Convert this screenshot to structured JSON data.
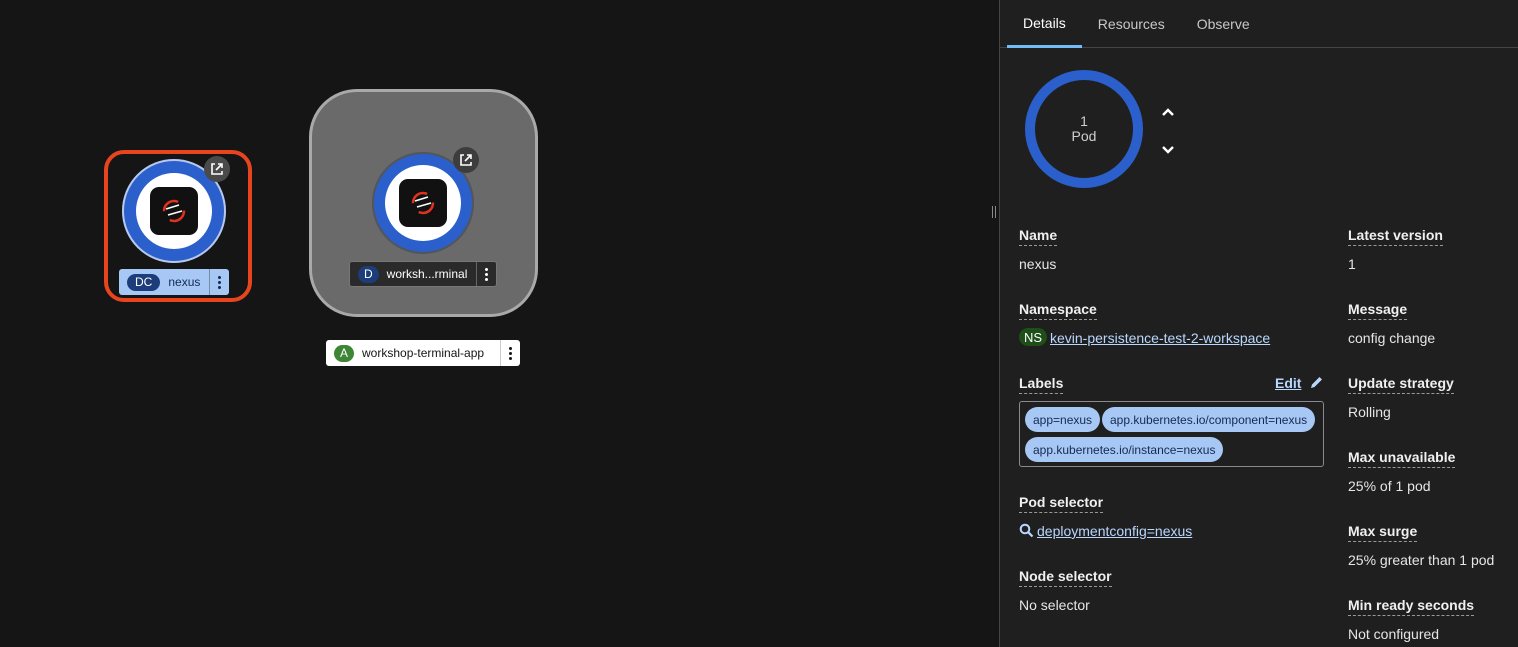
{
  "topology": {
    "nodes": [
      {
        "badge": "DC",
        "name": "nexus",
        "selected": true
      },
      {
        "badge": "D",
        "name": "worksh...rminal"
      }
    ],
    "application": {
      "badge": "A",
      "name": "workshop-terminal-app"
    }
  },
  "panel": {
    "tabs": [
      {
        "label": "Details",
        "active": true
      },
      {
        "label": "Resources"
      },
      {
        "label": "Observe"
      }
    ],
    "pods": {
      "count": "1",
      "unit": "Pod"
    },
    "fields": {
      "name": {
        "label": "Name",
        "value": "nexus"
      },
      "namespace": {
        "label": "Namespace",
        "badge": "NS",
        "value": "kevin-persistence-test-2-workspace"
      },
      "labels": {
        "label": "Labels",
        "edit": "Edit",
        "chips": [
          "app=nexus",
          "app.kubernetes.io/component=nexus",
          "app.kubernetes.io/instance=nexus"
        ]
      },
      "pod_selector": {
        "label": "Pod selector",
        "value": "deploymentconfig=nexus"
      },
      "node_selector": {
        "label": "Node selector",
        "value": "No selector"
      },
      "latest_version": {
        "label": "Latest version",
        "value": "1"
      },
      "message": {
        "label": "Message",
        "value": "config change"
      },
      "update_strategy": {
        "label": "Update strategy",
        "value": "Rolling"
      },
      "max_unavailable": {
        "label": "Max unavailable",
        "value": "25% of 1 pod"
      },
      "max_surge": {
        "label": "Max surge",
        "value": "25% greater than 1 pod"
      },
      "min_ready_seconds": {
        "label": "Min ready seconds",
        "value": "Not configured"
      }
    }
  },
  "colors": {
    "selection": "#e8451e",
    "pod_ring": "#2b5fcc",
    "tab_active": "#73bcf7",
    "chip": "#a7c8f4",
    "ns_badge": "#1e4f18",
    "app_badge": "#3e8635"
  }
}
